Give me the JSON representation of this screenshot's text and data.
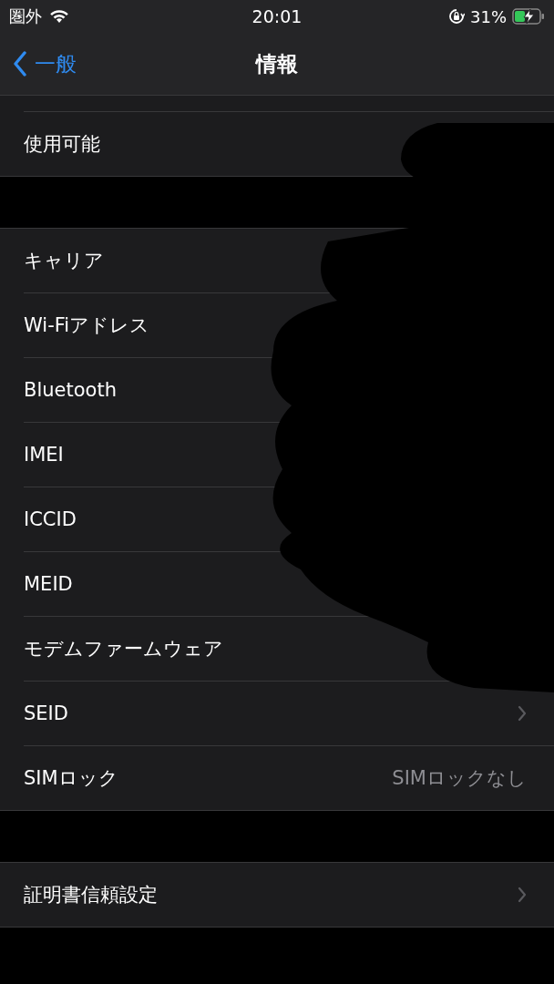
{
  "status_bar": {
    "carrier": "圏外",
    "time": "20:01",
    "battery_percent": "31%",
    "charging": true
  },
  "nav": {
    "back": "一般",
    "title": "情報"
  },
  "groups": [
    {
      "rows": [
        {
          "label": "使用可能",
          "kind": "plain"
        }
      ]
    },
    {
      "rows": [
        {
          "label": "キャリア",
          "kind": "plain"
        },
        {
          "label": "Wi-Fiアドレス",
          "kind": "plain"
        },
        {
          "label": "Bluetooth",
          "kind": "plain"
        },
        {
          "label": "IMEI",
          "kind": "plain"
        },
        {
          "label": "ICCID",
          "kind": "plain"
        },
        {
          "label": "MEID",
          "kind": "plain"
        },
        {
          "label": "モデムファームウェア",
          "kind": "plain"
        },
        {
          "label": "SEID",
          "kind": "chevron"
        },
        {
          "label": "SIMロック",
          "kind": "value",
          "value": "SIMロックなし"
        }
      ]
    },
    {
      "rows": [
        {
          "label": "証明書信頼設定",
          "kind": "chevron"
        }
      ]
    }
  ]
}
